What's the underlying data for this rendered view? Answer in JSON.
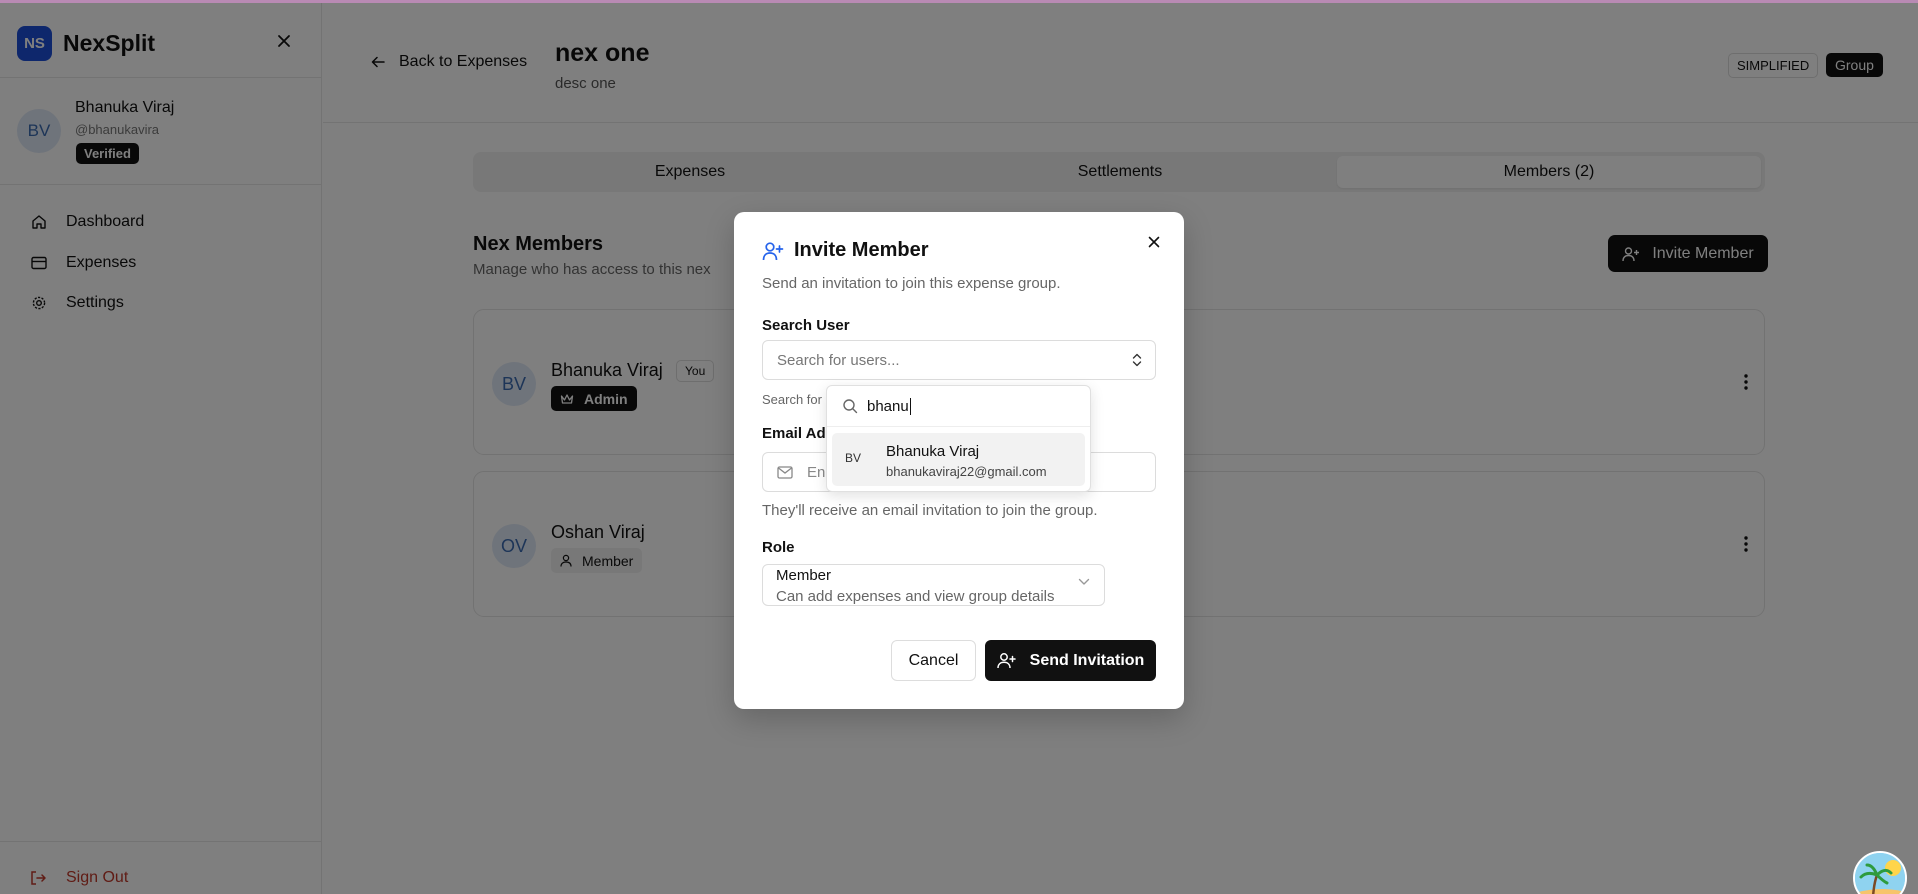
{
  "app": {
    "logo": "NS",
    "name": "NexSplit"
  },
  "user": {
    "initials": "BV",
    "name": "Bhanuka Viraj",
    "handle": "@bhanukavira",
    "badge": "Verified"
  },
  "nav": [
    {
      "label": "Dashboard",
      "icon": "home-icon"
    },
    {
      "label": "Expenses",
      "icon": "card-icon"
    },
    {
      "label": "Settings",
      "icon": "gear-icon"
    }
  ],
  "signout": "Sign Out",
  "header": {
    "back": "Back to Expenses",
    "title": "nex one",
    "desc": "desc one",
    "badge_simplified": "SIMPLIFIED",
    "badge_group": "Group"
  },
  "tabs": [
    "Expenses",
    "Settlements",
    "Members (2)"
  ],
  "members_section": {
    "title": "Nex Members",
    "subtitle": "Manage who has access to this nex",
    "invite_button": "Invite Member"
  },
  "members": [
    {
      "initials": "BV",
      "name": "Bhanuka Viraj",
      "you": "You",
      "role": "Admin"
    },
    {
      "initials": "OV",
      "name": "Oshan Viraj",
      "role": "Member"
    }
  ],
  "dialog": {
    "title": "Invite Member",
    "description": "Send an invitation to join this expense group.",
    "search_label": "Search User",
    "search_placeholder": "Search for users...",
    "search_help": "Search for",
    "email_label": "Email Ad",
    "email_placeholder": "En",
    "email_help": "They'll receive an email invitation to join the group.",
    "role_label": "Role",
    "role_value": "Member",
    "role_desc": "Can add expenses and view group details",
    "cancel": "Cancel",
    "send": "Send Invitation"
  },
  "dropdown": {
    "query": "bhanu",
    "results": [
      {
        "initials": "BV",
        "name": "Bhanuka Viraj",
        "email": "bhanukaviraj22@gmail.com"
      }
    ]
  }
}
